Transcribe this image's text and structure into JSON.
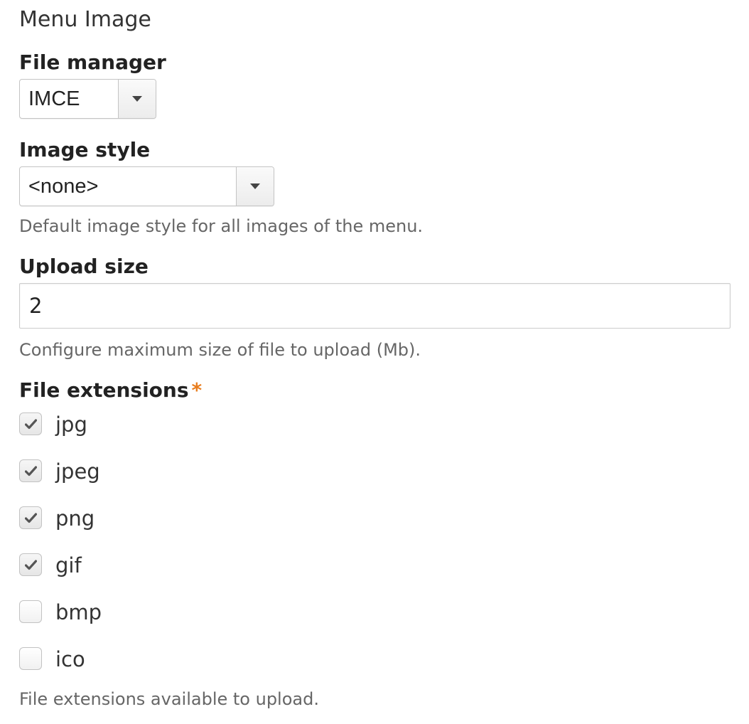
{
  "section": {
    "title": "Menu Image"
  },
  "file_manager": {
    "label": "File manager",
    "selected": "IMCE"
  },
  "image_style": {
    "label": "Image style",
    "selected": "<none>",
    "description": "Default image style for all images of the menu."
  },
  "upload_size": {
    "label": "Upload size",
    "value": "2",
    "description": "Configure maximum size of file to upload (Mb)."
  },
  "file_extensions": {
    "label": "File extensions",
    "required_marker": "*",
    "required_color": "#e87d1e",
    "options": [
      {
        "label": "jpg",
        "checked": true
      },
      {
        "label": "jpeg",
        "checked": true
      },
      {
        "label": "png",
        "checked": true
      },
      {
        "label": "gif",
        "checked": true
      },
      {
        "label": "bmp",
        "checked": false
      },
      {
        "label": "ico",
        "checked": false
      }
    ],
    "description": "File extensions available to upload."
  }
}
